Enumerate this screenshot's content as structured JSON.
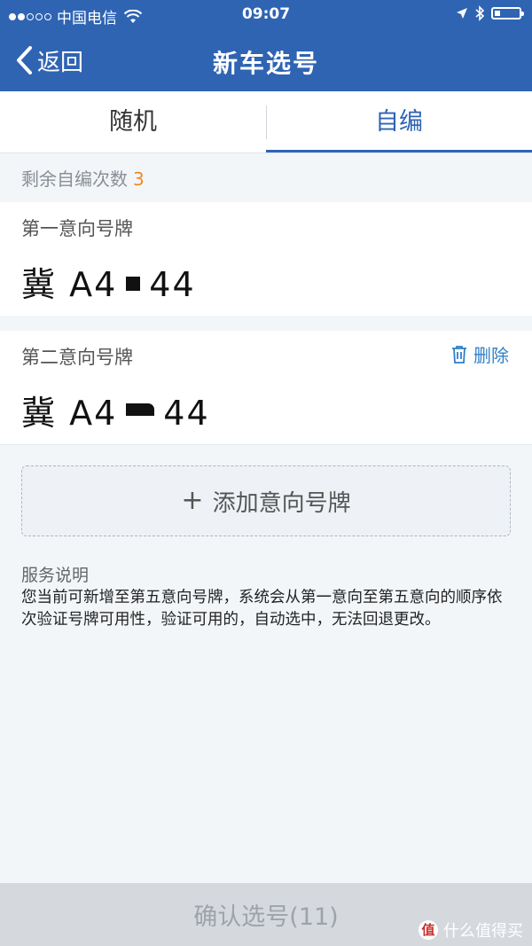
{
  "status_bar": {
    "carrier": "中国电信",
    "time": "09:07"
  },
  "nav": {
    "back_label": "返回",
    "title": "新车选号"
  },
  "tabs": [
    {
      "label": "随机",
      "active": false
    },
    {
      "label": "自编",
      "active": true
    }
  ],
  "remaining": {
    "label": "剩余自编次数",
    "count": "3"
  },
  "plates": [
    {
      "label": "第一意向号牌",
      "prefix": "冀 A4",
      "suffix": "44"
    },
    {
      "label": "第二意向号牌",
      "prefix": "冀 A4",
      "suffix": "44",
      "delete_label": "删除"
    }
  ],
  "add_plate": {
    "icon": "+",
    "label": "添加意向号牌"
  },
  "service": {
    "title": "服务说明",
    "text": "您当前可新增至第五意向号牌，系统会从第一意向至第五意向的顺序依次验证号牌可用性，验证可用的，自动选中，无法回退更改。"
  },
  "confirm": {
    "label": "确认选号(11)"
  },
  "watermark": {
    "logo": "值",
    "text": "什么值得买"
  },
  "colors": {
    "primary": "#2f64b3",
    "accent": "#f08a24",
    "link": "#2f7fc8"
  }
}
